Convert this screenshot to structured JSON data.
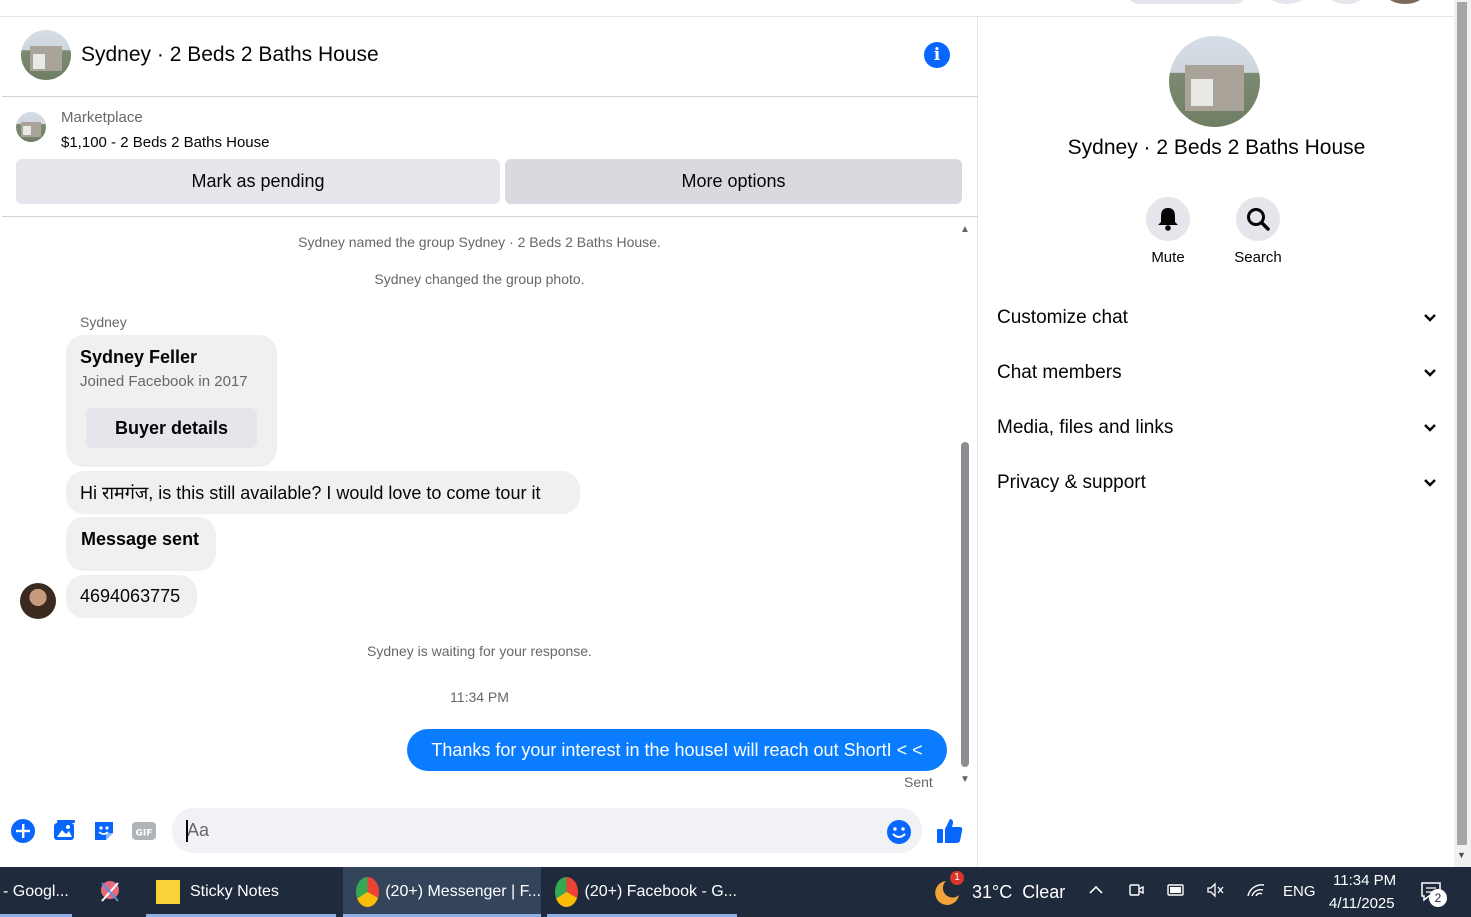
{
  "chat": {
    "title": "Sydney · 2 Beds 2 Baths House",
    "listing": {
      "label": "Marketplace",
      "price_title": "$1,100 - 2 Beds 2 Baths House"
    },
    "buttons": {
      "mark_pending": "Mark as pending",
      "more_options": "More options"
    },
    "system_messages": {
      "named_group": "Sydney named the group Sydney · 2 Beds 2 Baths House.",
      "changed_photo": "Sydney changed the group photo.",
      "waiting": "Sydney is waiting for your response."
    },
    "sender_name": "Sydney",
    "buyer_card": {
      "name": "Sydney Feller",
      "subtitle": "Joined Facebook in 2017",
      "button": "Buyer details"
    },
    "incoming_messages": [
      "Hi रामगंज, is this still available? I would love to come tour it",
      "Message sent",
      "4694063775"
    ],
    "timestamp": "11:34 PM",
    "outgoing_message": "Thanks for your interest in the houseI will reach out ShortI < <",
    "outgoing_status": "Sent",
    "composer": {
      "placeholder": "Aa"
    }
  },
  "details": {
    "title": "Sydney · 2 Beds 2 Baths House",
    "actions": [
      {
        "label": "Mute",
        "icon": "bell-icon"
      },
      {
        "label": "Search",
        "icon": "search-icon"
      }
    ],
    "sections": [
      "Customize chat",
      "Chat members",
      "Media, files and links",
      "Privacy & support"
    ]
  },
  "taskbar": {
    "items": [
      "- Googl...",
      "Sticky Notes",
      "(20+) Messenger | F...",
      "(20+) Facebook - G..."
    ],
    "weather": "31°C  Clear",
    "weather_badge": "1",
    "language": "ENG",
    "time": "11:34 PM",
    "date": "4/11/2025",
    "notification_count": "2"
  },
  "colors": {
    "accent": "#0866ff",
    "outgoing_bubble": "#0a7cff",
    "taskbar": "#1f2b3c"
  }
}
